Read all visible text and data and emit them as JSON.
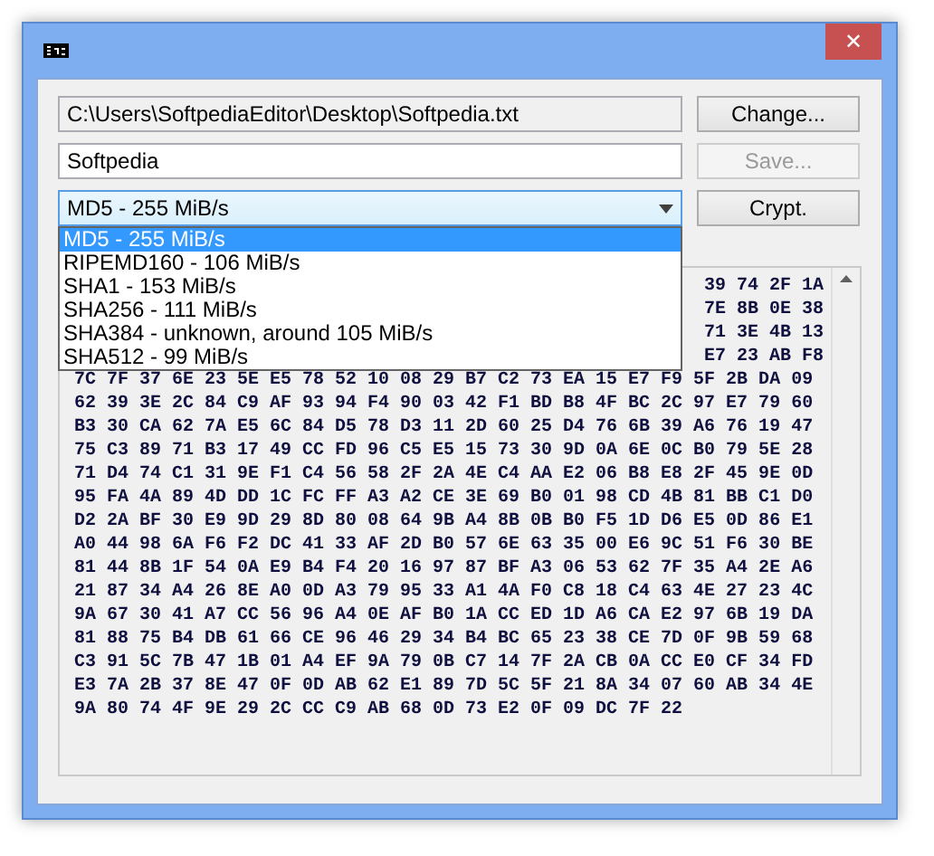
{
  "window": {
    "close": "✕"
  },
  "path_field": {
    "value": "C:\\Users\\SoftpediaEditor\\Desktop\\Softpedia.txt"
  },
  "buttons": [
    {
      "label": "Change...",
      "disabled": false
    },
    {
      "label": "Save...",
      "disabled": true
    },
    {
      "label": "Crypt.",
      "disabled": false
    }
  ],
  "name_field": {
    "value": "Softpedia"
  },
  "algorithm_combo": {
    "value": "MD5 - 255 MiB/s",
    "expanded": true,
    "options": [
      {
        "label": "MD5 - 255 MiB/s",
        "selected": true
      },
      {
        "label": "RIPEMD160 - 106 MiB/s",
        "selected": false
      },
      {
        "label": "SHA1 - 153 MiB/s",
        "selected": false
      },
      {
        "label": "SHA256 - 111 MiB/s",
        "selected": false
      },
      {
        "label": "SHA384 - unknown, around 105 MiB/s",
        "selected": false
      },
      {
        "label": "SHA512 - 99 MiB/s",
        "selected": false
      }
    ]
  },
  "hex_output": {
    "partly_hidden_rows": [
      "39 74 2F 1A",
      "7E 8B 0E 38",
      "71 3E 4B 13",
      "E7 23 AB F8"
    ],
    "rows": [
      "7C 7F 37 6E 23 5E E5 78 52 10 08 29 B7 C2 73 EA 15 E7 F9 5F 2B DA 09",
      "62 39 3E 2C 84 C9 AF 93 94 F4 90 03 42 F1 BD B8 4F BC 2C 97 E7 79 60",
      "B3 30 CA 62 7A E5 6C 84 D5 78 D3 11 2D 60 25 D4 76 6B 39 A6 76 19 47",
      "75 C3 89 71 B3 17 49 CC FD 96 C5 E5 15 73 30 9D 0A 6E 0C B0 79 5E 28",
      "71 D4 74 C1 31 9E F1 C4 56 58 2F 2A 4E C4 AA E2 06 B8 E8 2F 45 9E 0D",
      "95 FA 4A 89 4D DD 1C FC FF A3 A2 CE 3E 69 B0 01 98 CD 4B 81 BB C1 D0",
      "D2 2A BF 30 E9 9D 29 8D 80 08 64 9B A4 8B 0B B0 F5 1D D6 E5 0D 86 E1",
      "A0 44 98 6A F6 F2 DC 41 33 AF 2D B0 57 6E 63 35 00 E6 9C 51 F6 30 BE",
      "81 44 8B 1F 54 0A E9 B4 F4 20 16 97 87 BF A3 06 53 62 7F 35 A4 2E A6",
      "21 87 34 A4 26 8E A0 0D A3 79 95 33 A1 4A F0 C8 18 C4 63 4E 27 23 4C",
      "9A 67 30 41 A7 CC 56 96 A4 0E AF B0 1A CC ED 1D A6 CA E2 97 6B 19 DA",
      "81 88 75 B4 DB 61 66 CE 96 46 29 34 B4 BC 65 23 38 CE 7D 0F 9B 59 68",
      "C3 91 5C 7B 47 1B 01 A4 EF 9A 79 0B C7 14 7F 2A CB 0A CC E0 CF 34 FD",
      "E3 7A 2B 37 8E 47 0F 0D AB 62 E1 89 7D 5C 5F 21 8A 34 07 60 AB 34 4E",
      "9A 80 74 4F 9E 29 2C CC C9 AB 68 0D 73 E2 0F 09 DC 7F 22"
    ]
  }
}
